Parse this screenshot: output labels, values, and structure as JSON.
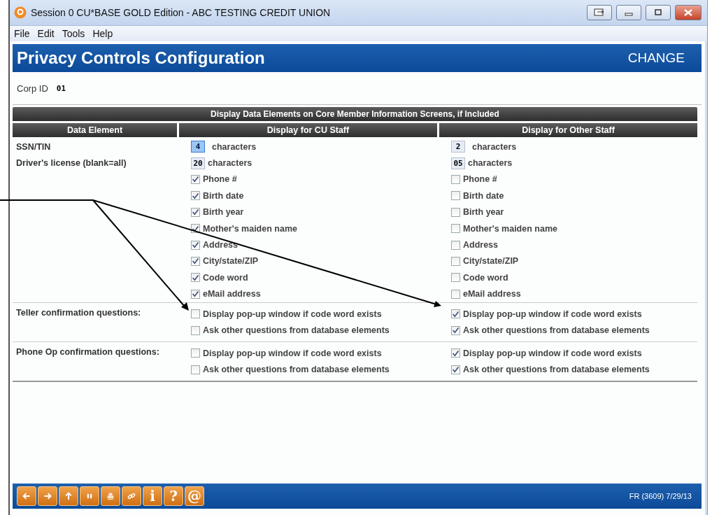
{
  "window": {
    "title": "Session 0 CU*BASE GOLD Edition - ABC TESTING CREDIT UNION"
  },
  "menu": [
    "File",
    "Edit",
    "Tools",
    "Help"
  ],
  "header": {
    "title": "Privacy Controls Configuration",
    "mode": "CHANGE"
  },
  "corp_id": {
    "label": "Corp ID",
    "value": "01"
  },
  "section_title": "Display Data Elements on Core Member Information Screens, if Included",
  "columns": [
    "Data Element",
    "Display for CU Staff",
    "Display for Other Staff"
  ],
  "display_rows": [
    {
      "kind": "count",
      "label": "SSN/TIN",
      "cu": {
        "value": "4",
        "unit": "characters",
        "focused": true
      },
      "other": {
        "value": "2",
        "unit": "characters",
        "focused": false
      }
    },
    {
      "kind": "count",
      "label": "Driver's license (blank=all)",
      "cu": {
        "value": "20",
        "unit": "characters",
        "focused": false
      },
      "other": {
        "value": "05",
        "unit": "characters",
        "focused": false
      }
    },
    {
      "kind": "check",
      "cu": {
        "label": "Phone #",
        "checked": true
      },
      "other": {
        "label": "Phone #",
        "checked": false
      }
    },
    {
      "kind": "check",
      "cu": {
        "label": "Birth date",
        "checked": true
      },
      "other": {
        "label": "Birth date",
        "checked": false
      }
    },
    {
      "kind": "check",
      "cu": {
        "label": "Birth year",
        "checked": true
      },
      "other": {
        "label": "Birth year",
        "checked": false
      }
    },
    {
      "kind": "check",
      "cu": {
        "label": "Mother's maiden name",
        "checked": true
      },
      "other": {
        "label": "Mother's maiden name",
        "checked": false
      }
    },
    {
      "kind": "check",
      "cu": {
        "label": "Address",
        "checked": true
      },
      "other": {
        "label": "Address",
        "checked": false
      }
    },
    {
      "kind": "check",
      "cu": {
        "label": "City/state/ZIP",
        "checked": true
      },
      "other": {
        "label": "City/state/ZIP",
        "checked": false
      }
    },
    {
      "kind": "check",
      "cu": {
        "label": "Code word",
        "checked": true
      },
      "other": {
        "label": "Code word",
        "checked": false
      }
    },
    {
      "kind": "check",
      "cu": {
        "label": "eMail address",
        "checked": true
      },
      "other": {
        "label": "eMail address",
        "checked": false
      }
    }
  ],
  "confirmation_groups": [
    {
      "label": "Teller confirmation questions:",
      "options": [
        {
          "cu": {
            "label": "Display pop-up window if code word exists",
            "checked": false
          },
          "other": {
            "label": "Display pop-up window if code word exists",
            "checked": true
          }
        },
        {
          "cu": {
            "label": "Ask other questions from database elements",
            "checked": false
          },
          "other": {
            "label": "Ask other questions from database elements",
            "checked": true
          }
        }
      ]
    },
    {
      "label": "Phone Op confirmation questions:",
      "options": [
        {
          "cu": {
            "label": "Display pop-up window if code word exists",
            "checked": false
          },
          "other": {
            "label": "Display pop-up window if code word exists",
            "checked": true
          }
        },
        {
          "cu": {
            "label": "Ask other questions from database elements",
            "checked": false
          },
          "other": {
            "label": "Ask other questions from database elements",
            "checked": true
          }
        }
      ]
    }
  ],
  "toolbar": [
    {
      "kind": "back"
    },
    {
      "kind": "forward"
    },
    {
      "kind": "up"
    },
    {
      "kind": "pause"
    },
    {
      "kind": "print"
    },
    {
      "kind": "link"
    },
    {
      "kind": "char",
      "char": "i"
    },
    {
      "kind": "char",
      "char": "?"
    },
    {
      "kind": "char",
      "char": "@"
    }
  ],
  "status": "FR (3609) 7/29/13"
}
